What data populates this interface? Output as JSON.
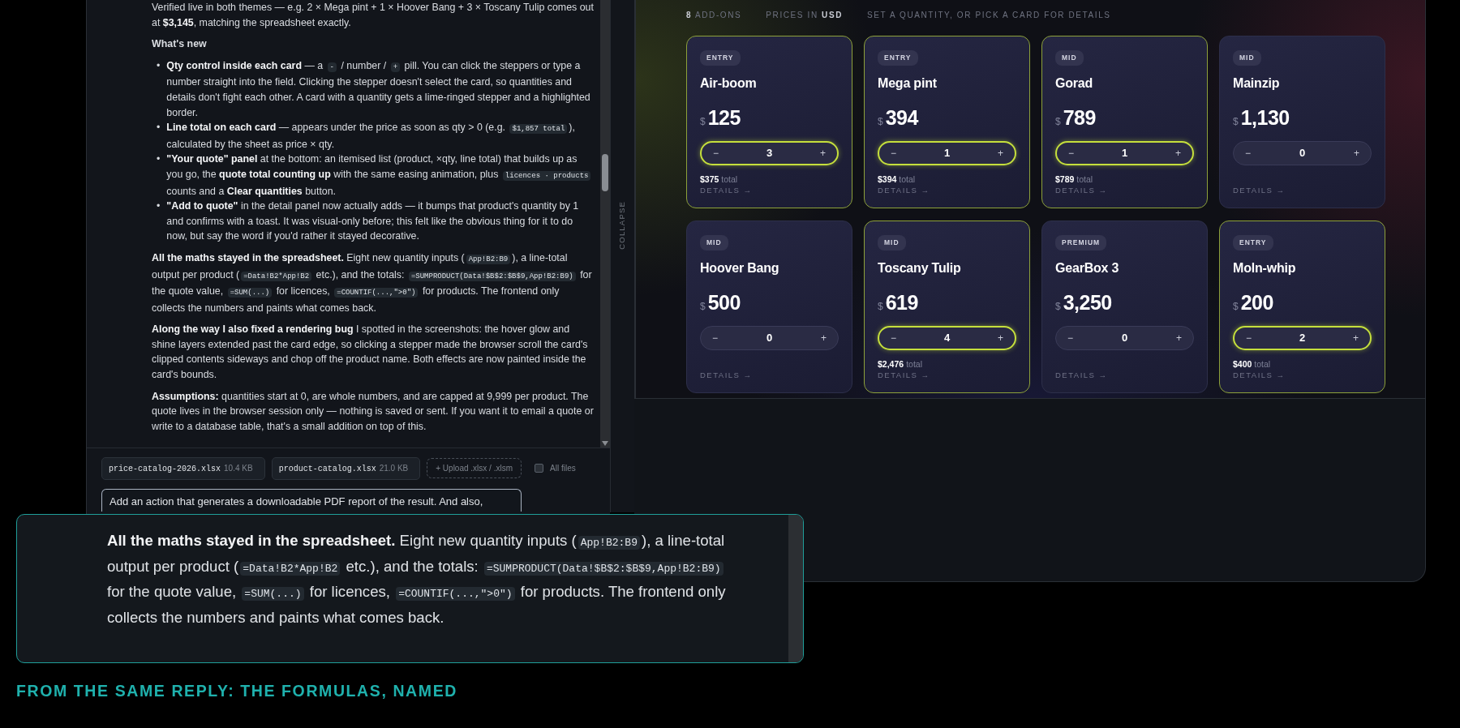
{
  "chat": {
    "blocks": [
      {
        "kind": "paragraph",
        "segments": [
          {
            "kind": "text",
            "text": "Verified live in both themes — e.g. 2 × Mega pint + 1 × Hoover Bang + 3 × Toscany Tulip comes out at **$3,145**, matching the spreadsheet exactly."
          }
        ]
      },
      {
        "kind": "heading",
        "segments": [
          {
            "kind": "text",
            "text": "What's new"
          }
        ]
      },
      {
        "kind": "list",
        "items": [
          {
            "marker": "•",
            "segments": [
              {
                "kind": "text",
                "text": "**Qty control inside each card** — a "
              },
              {
                "kind": "code",
                "text": "-"
              },
              {
                "kind": "text",
                "text": " / number / "
              },
              {
                "kind": "code",
                "text": "+"
              },
              {
                "kind": "text",
                "text": " pill. You can click the steppers or type a number straight into the field. Clicking the stepper doesn't select the card, so quantities and details don't fight each other. A card with a quantity gets a lime-ringed stepper and a highlighted border."
              }
            ]
          },
          {
            "marker": "•",
            "segments": [
              {
                "kind": "text",
                "text": "**Line total on each card** — appears under the price as soon as qty > 0 (e.g. "
              },
              {
                "kind": "code",
                "text": "$1,857 total"
              },
              {
                "kind": "text",
                "text": "), calculated by the sheet as price × qty."
              }
            ]
          },
          {
            "marker": "•",
            "segments": [
              {
                "kind": "text",
                "text": "**\"Your quote\" panel** at the bottom: an itemised list (product, ×qty, line total) that builds up as you go, the **quote total counting up** with the same easing animation, plus "
              },
              {
                "kind": "code",
                "text": "licences · products"
              },
              {
                "kind": "text",
                "text": " counts and a **Clear quantities** button."
              }
            ]
          },
          {
            "marker": "•",
            "segments": [
              {
                "kind": "text",
                "text": "**\"Add to quote\"** in the detail panel now actually adds — it bumps that product's quantity by 1 and confirms with a toast. It was visual-only before; this felt like the obvious thing for it to do now, but say the word if you'd rather it stayed decorative."
              }
            ]
          }
        ]
      },
      {
        "kind": "paragraph",
        "segments": [
          {
            "kind": "text",
            "text": "**All the maths stayed in the spreadsheet.** Eight new quantity inputs ("
          },
          {
            "kind": "code",
            "text": "App!B2:B9"
          },
          {
            "kind": "text",
            "text": "), a line-total output per product ("
          },
          {
            "kind": "code",
            "text": "=Data!B2*App!B2"
          },
          {
            "kind": "text",
            "text": " etc.), and the totals: "
          },
          {
            "kind": "code",
            "text": "=SUMPRODUCT(Data!$B$2:$B$9,App!B2:B9)"
          },
          {
            "kind": "text",
            "text": " for the quote value, "
          },
          {
            "kind": "code",
            "text": "=SUM(...)"
          },
          {
            "kind": "text",
            "text": " for licences, "
          },
          {
            "kind": "code",
            "text": "=COUNTIF(...,\">0\")"
          },
          {
            "kind": "text",
            "text": " for products. The frontend only collects the numbers and paints what comes back."
          }
        ]
      },
      {
        "kind": "paragraph",
        "segments": [
          {
            "kind": "text",
            "text": "**Along the way I also fixed a rendering bug** I spotted in the screenshots: the hover glow and shine layers extended past the card edge, so clicking a stepper made the browser scroll the card's clipped contents sideways and chop off the product name. Both effects are now painted inside the card's bounds."
          }
        ]
      },
      {
        "kind": "paragraph",
        "segments": [
          {
            "kind": "text",
            "text": "**Assumptions:** quantities start at 0, are whole numbers, and are capped at 9,999 per product. The quote lives in the browser session only — nothing is saved or sent. If you want it to email a quote or write to a database table, that's a small addition on top of this."
          }
        ]
      }
    ]
  },
  "files": [
    {
      "name": "price-catalog-2026.xlsx",
      "size": "10.4 KB"
    },
    {
      "name": "product-catalog.xlsx",
      "size": "21.0 KB"
    }
  ],
  "upload": {
    "icon": "+",
    "label": "Upload .xlsx / .xlsm"
  },
  "all_files": {
    "label": "All files",
    "checked": false
  },
  "prompt": {
    "value": "Add an action that generates a downloadable PDF report of the result. And also,"
  },
  "collapse": {
    "label": "COLLAPSE"
  },
  "app": {
    "meta": [
      "**8** ADD-ONS",
      "PRICES IN **USD**",
      "SET A QUANTITY, OR PICK A CARD FOR DETAILS"
    ],
    "cards": [
      {
        "tier": "ENTRY",
        "name": "Air-boom",
        "currency": "$",
        "price": "125",
        "minus": "−",
        "qty": "3",
        "plus": "+",
        "highlighted": true,
        "line_total": "$375",
        "line_total_label": "total",
        "details": "DETAILS →"
      },
      {
        "tier": "ENTRY",
        "name": "Mega pint",
        "currency": "$",
        "price": "394",
        "minus": "−",
        "qty": "1",
        "plus": "+",
        "highlighted": true,
        "line_total": "$394",
        "line_total_label": "total",
        "details": "DETAILS →"
      },
      {
        "tier": "MID",
        "name": "Gorad",
        "currency": "$",
        "price": "789",
        "minus": "−",
        "qty": "1",
        "plus": "+",
        "highlighted": true,
        "line_total": "$789",
        "line_total_label": "total",
        "details": "DETAILS →"
      },
      {
        "tier": "MID",
        "name": "Mainzip",
        "currency": "$",
        "price": "1,130",
        "minus": "−",
        "qty": "0",
        "plus": "+",
        "highlighted": false,
        "details": "DETAILS →"
      },
      {
        "tier": "MID",
        "name": "Hoover Bang",
        "currency": "$",
        "price": "500",
        "minus": "−",
        "qty": "0",
        "plus": "+",
        "highlighted": false,
        "details": "DETAILS →"
      },
      {
        "tier": "MID",
        "name": "Toscany Tulip",
        "currency": "$",
        "price": "619",
        "minus": "−",
        "qty": "4",
        "plus": "+",
        "highlighted": true,
        "line_total": "$2,476",
        "line_total_label": "total",
        "details": "DETAILS →"
      },
      {
        "tier": "PREMIUM",
        "name": "GearBox 3",
        "currency": "$",
        "price": "3,250",
        "minus": "−",
        "qty": "0",
        "plus": "+",
        "highlighted": false,
        "details": "DETAILS →"
      },
      {
        "tier": "ENTRY",
        "name": "Moln-whip",
        "currency": "$",
        "price": "200",
        "minus": "−",
        "qty": "2",
        "plus": "+",
        "highlighted": true,
        "line_total": "$400",
        "line_total_label": "total",
        "details": "DETAILS →"
      }
    ]
  },
  "callout": {
    "segments": [
      {
        "kind": "text",
        "text": "**All the maths stayed in the spreadsheet.** Eight new quantity inputs ("
      },
      {
        "kind": "code",
        "text": "App!B2:B9"
      },
      {
        "kind": "text",
        "text": "), a line-total output per product ("
      },
      {
        "kind": "code",
        "text": "=Data!B2*App!B2"
      },
      {
        "kind": "text",
        "text": " etc.), and the totals: "
      },
      {
        "kind": "code",
        "text": "=SUMPRODUCT(Data!$B$2:$B$9,App!B2:B9)"
      },
      {
        "kind": "text",
        "text": " for the quote value, "
      },
      {
        "kind": "code",
        "text": "=SUM(...)"
      },
      {
        "kind": "text",
        "text": " for licences, "
      },
      {
        "kind": "code",
        "text": "=COUNTIF(...,\">0\")"
      },
      {
        "kind": "text",
        "text": " for products. The frontend only collects the numbers and paints what comes back."
      }
    ]
  },
  "caption": "FROM THE SAME REPLY: THE FORMULAS, NAMED"
}
